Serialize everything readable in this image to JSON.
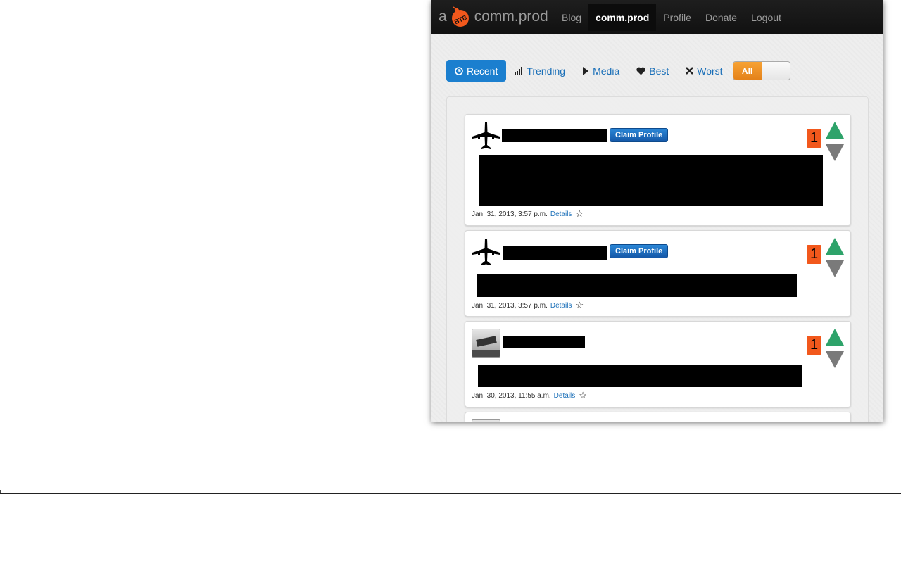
{
  "header": {
    "brand_prefix": "a",
    "brand_name": "comm.prod",
    "logo_text": "BTB",
    "nav": [
      "Blog",
      "comm.prod",
      "Profile",
      "Donate",
      "Logout"
    ],
    "active_nav": "comm.prod"
  },
  "filters": {
    "items": [
      {
        "label": "Recent",
        "icon": "clock-icon",
        "active": true
      },
      {
        "label": "Trending",
        "icon": "signal-bars-icon",
        "active": false
      },
      {
        "label": "Media",
        "icon": "play-icon",
        "active": false
      },
      {
        "label": "Best",
        "icon": "heart-icon",
        "active": false
      },
      {
        "label": "Worst",
        "icon": "x-icon",
        "active": false
      }
    ],
    "toggle_label": "All",
    "toggle_on_color": "#f39a2e"
  },
  "posts": [
    {
      "avatar": "airplane-icon",
      "claim_label": "Claim Profile",
      "score": "1",
      "date": "Jan. 31, 2013, 3:57 p.m.",
      "details_label": "Details"
    },
    {
      "avatar": "airplane-icon",
      "claim_label": "Claim Profile",
      "score": "1",
      "date": "Jan. 31, 2013, 3:57 p.m.",
      "details_label": "Details"
    },
    {
      "avatar": "user-photo",
      "score": "1",
      "date": "Jan. 30, 2013, 11:55 a.m.",
      "details_label": "Details"
    }
  ],
  "colors": {
    "score_badge": "#f2581c",
    "upvote": "#2ea36a",
    "downvote": "#7a7a7a",
    "active_filter": "#1b7fcf",
    "link": "#1a6fb8"
  }
}
